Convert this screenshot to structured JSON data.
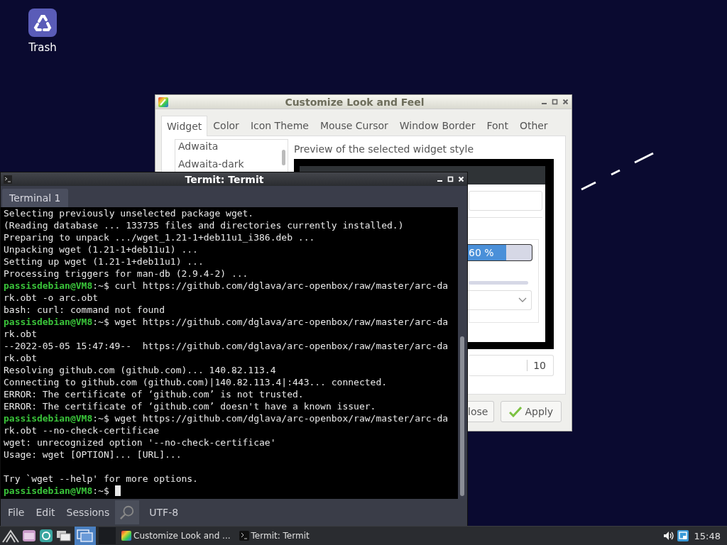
{
  "desktop": {
    "icons": [
      {
        "label": "Trash"
      }
    ]
  },
  "customize_window": {
    "title": "Customize Look and Feel",
    "tabs": [
      {
        "label": "Widget",
        "selected": true
      },
      {
        "label": "Color",
        "selected": false
      },
      {
        "label": "Icon Theme",
        "selected": false
      },
      {
        "label": "Mouse Cursor",
        "selected": false
      },
      {
        "label": "Window Border",
        "selected": false
      },
      {
        "label": "Font",
        "selected": false
      },
      {
        "label": "Other",
        "selected": false
      }
    ],
    "theme_list": [
      "Adwaita",
      "Adwaita-dark"
    ],
    "preview_label": "Preview of the selected widget style",
    "preview": {
      "progress": {
        "text": "60 %",
        "level": 0.6
      },
      "spin_value": "10"
    },
    "buttons": [
      {
        "label": "lose",
        "kind": "plain"
      },
      {
        "label": "Apply",
        "kind": "apply"
      }
    ]
  },
  "terminal_window": {
    "title": "Termit: Termit",
    "tabs": [
      {
        "label": "Terminal 1",
        "selected": true
      }
    ],
    "lines": [
      {
        "kind": "output",
        "text": "Selecting previously unselected package wget."
      },
      {
        "kind": "output",
        "text": "(Reading database ... 133735 files and directories currently installed.)"
      },
      {
        "kind": "output",
        "text": "Preparing to unpack .../wget_1.21-1+deb11u1_i386.deb ..."
      },
      {
        "kind": "output",
        "text": "Unpacking wget (1.21-1+deb11u1) ..."
      },
      {
        "kind": "output",
        "text": "Setting up wget (1.21-1+deb11u1) ..."
      },
      {
        "kind": "output",
        "text": "Processing triggers for man-db (2.9.4-2) ..."
      },
      {
        "kind": "prompt",
        "prompt": "passisdebian@VM8",
        "text": ":~$ curl https://github.com/dglava/arc-openbox/raw/master/arc-da"
      },
      {
        "kind": "output",
        "text": "rk.obt -o arc.obt"
      },
      {
        "kind": "output",
        "text": "bash: curl: command not found"
      },
      {
        "kind": "prompt",
        "prompt": "passisdebian@VM8",
        "text": ":~$ wget https://github.com/dglava/arc-openbox/raw/master/arc-da"
      },
      {
        "kind": "output",
        "text": "rk.obt"
      },
      {
        "kind": "output",
        "text": "--2022-05-05 15:47:49--  https://github.com/dglava/arc-openbox/raw/master/arc-da"
      },
      {
        "kind": "output",
        "text": "rk.obt"
      },
      {
        "kind": "output",
        "text": "Resolving github.com (github.com)... 140.82.113.4"
      },
      {
        "kind": "output",
        "text": "Connecting to github.com (github.com)|140.82.113.4|:443... connected."
      },
      {
        "kind": "output",
        "text": "ERROR: The certificate of ‘github.com’ is not trusted."
      },
      {
        "kind": "output",
        "text": "ERROR: The certificate of ‘github.com’ doesn't have a known issuer."
      },
      {
        "kind": "prompt",
        "prompt": "passisdebian@VM8",
        "text": ":~$ wget https://github.com/dglava/arc-openbox/raw/master/arc-da"
      },
      {
        "kind": "output",
        "text": "rk.obt --no-check-certificae"
      },
      {
        "kind": "output",
        "text": "wget: unrecognized option '--no-check-certificae'"
      },
      {
        "kind": "output",
        "text": "Usage: wget [OPTION]... [URL]..."
      },
      {
        "kind": "blank"
      },
      {
        "kind": "output",
        "text": "Try `wget --help' for more options."
      },
      {
        "kind": "prompt",
        "prompt": "passisdebian@VM8",
        "text": ":~$ ",
        "cursor": true
      }
    ],
    "menu": [
      "File",
      "Edit",
      "Sessions"
    ],
    "encoding": "UTF-8"
  },
  "taskbar": {
    "tasks": [
      {
        "label": "Customize Look and ...",
        "kind": "customize"
      },
      {
        "label": "Termit: Termit",
        "kind": "terminal"
      }
    ],
    "clock": "15:48"
  }
}
